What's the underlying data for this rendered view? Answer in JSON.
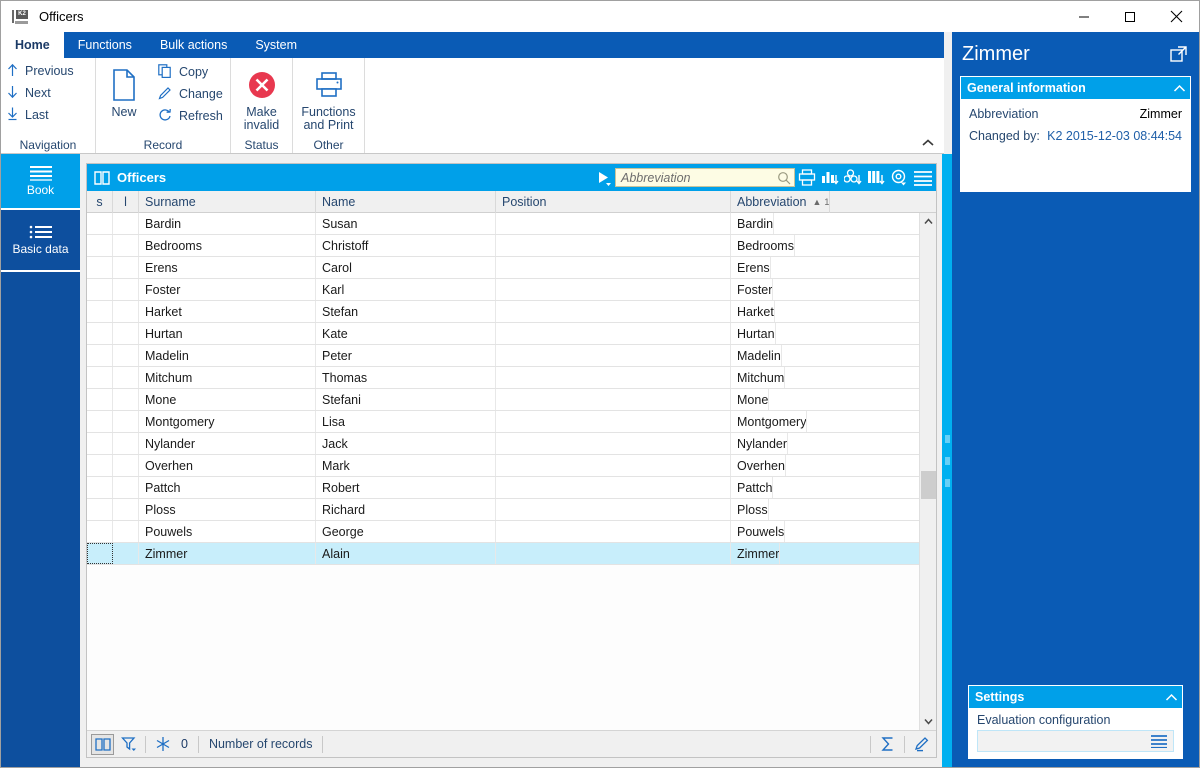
{
  "window": {
    "title": "Officers",
    "icon": "app-icon",
    "controls": {
      "minimize": "minimize",
      "maximize": "maximize",
      "close": "close"
    }
  },
  "ribbon": {
    "tabs": [
      {
        "label": "Home",
        "active": true
      },
      {
        "label": "Functions",
        "active": false
      },
      {
        "label": "Bulk actions",
        "active": false
      },
      {
        "label": "System",
        "active": false
      }
    ],
    "groups": [
      {
        "label": "Navigation",
        "commands": [
          {
            "label": "Previous",
            "icon": "arrow-up-icon"
          },
          {
            "label": "Next",
            "icon": "arrow-down-icon"
          },
          {
            "label": "Last",
            "icon": "arrow-down-bar-icon"
          }
        ]
      },
      {
        "label": "Record",
        "big": {
          "label": "New",
          "icon": "new-document-icon"
        },
        "commands": [
          {
            "label": "Copy",
            "icon": "copy-icon"
          },
          {
            "label": "Change",
            "icon": "pencil-icon"
          },
          {
            "label": "Refresh",
            "icon": "refresh-icon"
          }
        ]
      },
      {
        "label": "Status",
        "big": {
          "label": "Make invalid",
          "icon": "red-x-circle-icon"
        }
      },
      {
        "label": "Other",
        "big": {
          "label": "Functions and Print",
          "icon": "printer-icon"
        }
      }
    ],
    "collapse_icon": "chevron-up-icon"
  },
  "sidebar": {
    "items": [
      {
        "label": "Book",
        "icon": "book-lines-icon",
        "selected": true
      },
      {
        "label": "Basic data",
        "icon": "list-icon",
        "selected": false
      }
    ]
  },
  "grid": {
    "title": "Officers",
    "title_icon": "book-icon",
    "expand_icon": "play-arrow-icon",
    "search": {
      "placeholder": "Abbreviation",
      "value": "",
      "icon": "search-icon"
    },
    "toolbar_icons": [
      "print-icon",
      "chart-export-icon",
      "group-export-icon",
      "columns-export-icon",
      "settings-gear-icon",
      "menu-icon"
    ],
    "columns": [
      {
        "key": "s",
        "label": "s"
      },
      {
        "key": "l",
        "label": "l"
      },
      {
        "key": "surname",
        "label": "Surname"
      },
      {
        "key": "name",
        "label": "Name"
      },
      {
        "key": "position",
        "label": "Position"
      },
      {
        "key": "abbreviation",
        "label": "Abbreviation",
        "sort": "asc",
        "sort_index": "1"
      }
    ],
    "rows": [
      {
        "s": "",
        "l": "",
        "surname": "Bardin",
        "name": "Susan",
        "position": "",
        "abbreviation": "Bardin",
        "selected": false
      },
      {
        "s": "",
        "l": "",
        "surname": "Bedrooms",
        "name": "Christoff",
        "position": "",
        "abbreviation": "Bedrooms",
        "selected": false
      },
      {
        "s": "",
        "l": "",
        "surname": "Erens",
        "name": "Carol",
        "position": "",
        "abbreviation": "Erens",
        "selected": false
      },
      {
        "s": "",
        "l": "",
        "surname": "Foster",
        "name": "Karl",
        "position": "",
        "abbreviation": "Foster",
        "selected": false
      },
      {
        "s": "",
        "l": "",
        "surname": "Harket",
        "name": "Stefan",
        "position": "",
        "abbreviation": "Harket",
        "selected": false
      },
      {
        "s": "",
        "l": "",
        "surname": "Hurtan",
        "name": "Kate",
        "position": "",
        "abbreviation": "Hurtan",
        "selected": false
      },
      {
        "s": "",
        "l": "",
        "surname": "Madelin",
        "name": "Peter",
        "position": "",
        "abbreviation": "Madelin",
        "selected": false
      },
      {
        "s": "",
        "l": "",
        "surname": "Mitchum",
        "name": "Thomas",
        "position": "",
        "abbreviation": "Mitchum",
        "selected": false
      },
      {
        "s": "",
        "l": "",
        "surname": "Mone",
        "name": "Stefani",
        "position": "",
        "abbreviation": "Mone",
        "selected": false
      },
      {
        "s": "",
        "l": "",
        "surname": "Montgomery",
        "name": "Lisa",
        "position": "",
        "abbreviation": "Montgomery",
        "selected": false
      },
      {
        "s": "",
        "l": "",
        "surname": "Nylander",
        "name": "Jack",
        "position": "",
        "abbreviation": "Nylander",
        "selected": false
      },
      {
        "s": "",
        "l": "",
        "surname": "Overhen",
        "name": "Mark",
        "position": "",
        "abbreviation": "Overhen",
        "selected": false
      },
      {
        "s": "",
        "l": "",
        "surname": "Pattch",
        "name": "Robert",
        "position": "",
        "abbreviation": "Pattch",
        "selected": false
      },
      {
        "s": "",
        "l": "",
        "surname": "Ploss",
        "name": "Richard",
        "position": "",
        "abbreviation": "Ploss",
        "selected": false
      },
      {
        "s": "",
        "l": "",
        "surname": "Pouwels",
        "name": "George",
        "position": "",
        "abbreviation": "Pouwels",
        "selected": false
      },
      {
        "s": "",
        "l": "",
        "surname": "Zimmer",
        "name": "Alain",
        "position": "",
        "abbreviation": "Zimmer",
        "selected": true
      }
    ],
    "status": {
      "book_icon": "book-view-icon",
      "filter_icon": "filter-icon",
      "snowflake_icon": "snowflake-icon",
      "count": "0",
      "records_label": "Number of records",
      "sum_icon": "sigma-icon",
      "edit_icon": "pencil-edit-icon"
    }
  },
  "right_panel": {
    "title": "Zimmer",
    "popout_icon": "open-external-icon",
    "general": {
      "header": "General information",
      "chevron": "chevron-up-icon",
      "rows": [
        {
          "label": "Abbreviation",
          "value": "Zimmer"
        },
        {
          "label": "Changed by:",
          "value": "K2 2015-12-03 08:44:54"
        }
      ]
    },
    "settings": {
      "header": "Settings",
      "chevron": "chevron-up-icon",
      "field_label": "Evaluation configuration",
      "field_value": "",
      "menu_icon": "menu-icon"
    }
  },
  "colors": {
    "ribbon_blue": "#0a5bb5",
    "accent_cyan": "#00a0e9",
    "sidebar_blue": "#0d4f9e",
    "selection": "#c8eefb",
    "text_blue": "#26476f",
    "red": "#e8384f"
  }
}
